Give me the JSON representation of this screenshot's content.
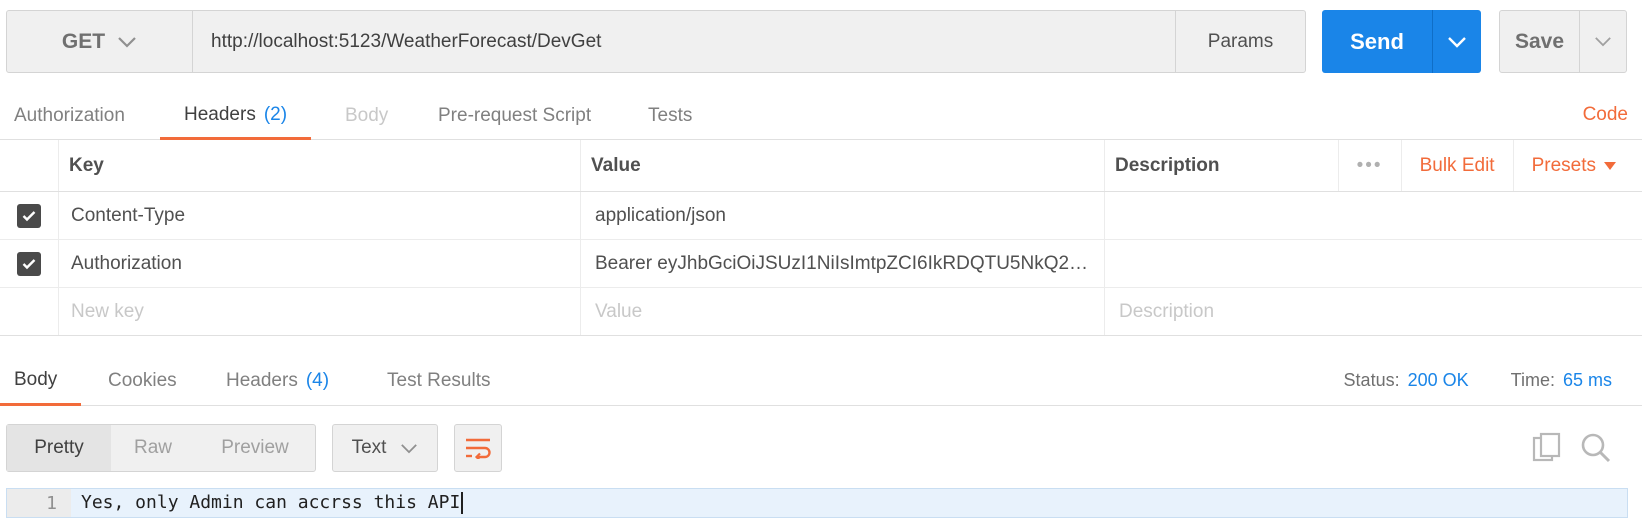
{
  "request": {
    "method": "GET",
    "url": "http://localhost:5123/WeatherForecast/DevGet",
    "params_label": "Params",
    "send_label": "Send",
    "save_label": "Save"
  },
  "request_tabs": [
    {
      "label": "Authorization"
    },
    {
      "label": "Headers",
      "count": "(2)"
    },
    {
      "label": "Body"
    },
    {
      "label": "Pre-request Script"
    },
    {
      "label": "Tests"
    }
  ],
  "code_label": "Code",
  "headers_table": {
    "columns": {
      "key": "Key",
      "value": "Value",
      "description": "Description"
    },
    "tools": {
      "dots": "•••",
      "bulk_edit": "Bulk Edit",
      "presets": "Presets"
    },
    "rows": [
      {
        "key": "Content-Type",
        "value": "application/json"
      },
      {
        "key": "Authorization",
        "value": "Bearer eyJhbGciOiJSUzI1NiIsImtpZCI6IkRDQTU5NkQ2…"
      }
    ],
    "new_row": {
      "key_placeholder": "New key",
      "value_placeholder": "Value",
      "description_placeholder": "Description"
    }
  },
  "response_tabs": [
    {
      "label": "Body"
    },
    {
      "label": "Cookies"
    },
    {
      "label": "Headers",
      "count": "(4)"
    },
    {
      "label": "Test Results"
    }
  ],
  "status": {
    "status_label": "Status:",
    "status_value": "200 OK",
    "time_label": "Time:",
    "time_value": "65 ms"
  },
  "response_toolbar": {
    "views": [
      "Pretty",
      "Raw",
      "Preview"
    ],
    "format": "Text"
  },
  "response_body": {
    "line_number": "1",
    "text": "Yes, only Admin can accrss this API"
  },
  "colors": {
    "accent": "#f26b3a",
    "primary": "#1a85e8"
  }
}
